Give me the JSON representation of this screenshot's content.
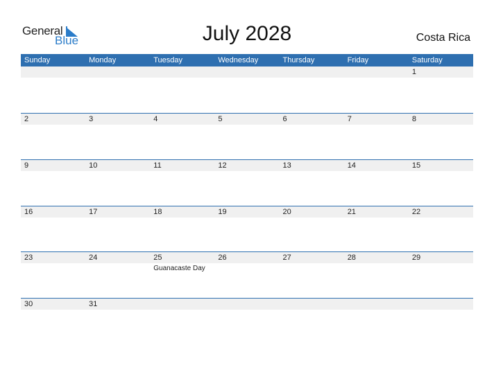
{
  "logo": {
    "general": "General",
    "blue": "Blue"
  },
  "title": "July 2028",
  "country": "Costa Rica",
  "weekdays": [
    "Sunday",
    "Monday",
    "Tuesday",
    "Wednesday",
    "Thursday",
    "Friday",
    "Saturday"
  ],
  "colors": {
    "accent": "#2e6fb0",
    "band": "#f0f0f0"
  },
  "weeks": [
    [
      {
        "day": ""
      },
      {
        "day": ""
      },
      {
        "day": ""
      },
      {
        "day": ""
      },
      {
        "day": ""
      },
      {
        "day": ""
      },
      {
        "day": "1"
      }
    ],
    [
      {
        "day": "2"
      },
      {
        "day": "3"
      },
      {
        "day": "4"
      },
      {
        "day": "5"
      },
      {
        "day": "6"
      },
      {
        "day": "7"
      },
      {
        "day": "8"
      }
    ],
    [
      {
        "day": "9"
      },
      {
        "day": "10"
      },
      {
        "day": "11"
      },
      {
        "day": "12"
      },
      {
        "day": "13"
      },
      {
        "day": "14"
      },
      {
        "day": "15"
      }
    ],
    [
      {
        "day": "16"
      },
      {
        "day": "17"
      },
      {
        "day": "18"
      },
      {
        "day": "19"
      },
      {
        "day": "20"
      },
      {
        "day": "21"
      },
      {
        "day": "22"
      }
    ],
    [
      {
        "day": "23"
      },
      {
        "day": "24"
      },
      {
        "day": "25",
        "event": "Guanacaste Day"
      },
      {
        "day": "26"
      },
      {
        "day": "27"
      },
      {
        "day": "28"
      },
      {
        "day": "29"
      }
    ],
    [
      {
        "day": "30"
      },
      {
        "day": "31"
      },
      {
        "day": ""
      },
      {
        "day": ""
      },
      {
        "day": ""
      },
      {
        "day": ""
      },
      {
        "day": ""
      }
    ]
  ]
}
